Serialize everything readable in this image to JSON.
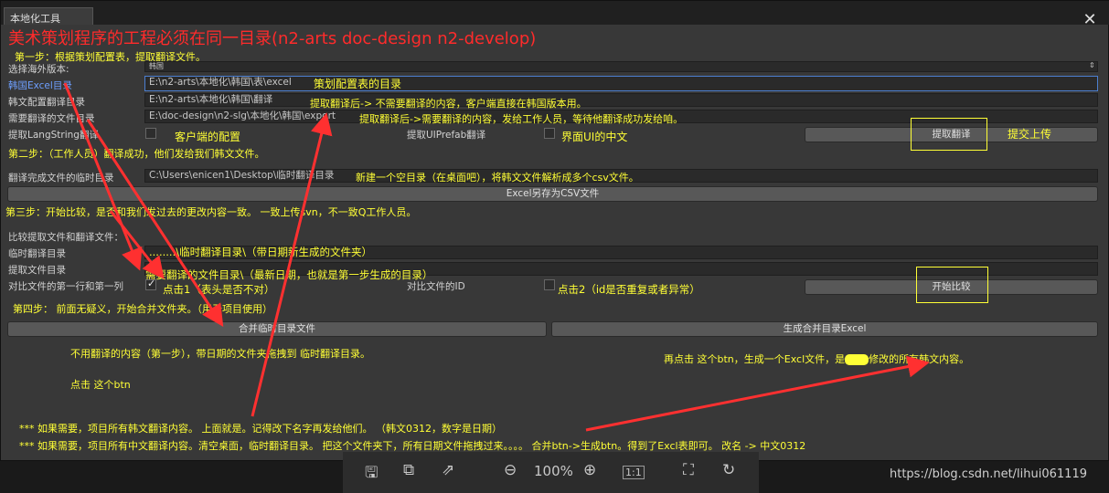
{
  "window": {
    "tab_title": "本地化工具",
    "close_glyph": "✕"
  },
  "notes": {
    "headline": "美术策划程序的工程必须在同一目录(n2-arts  doc-design  n2-develop)",
    "step1": "第一步：根据策划配置表，提取翻译文件。",
    "excel_hint": "策划配置表的目录",
    "korean_hint": "提取翻译后-> 不需要翻译的内容，客户端直接在韩国版本用。",
    "need_hint": "提取翻译后->需要翻译的内容，发给工作人员，等待他翻译成功发给咱。",
    "client_cfg": "客户端的配置",
    "ui_cn": "界面UI的中文",
    "submit_upload": "提交上传",
    "step2": "第二步：（工作人员）翻译成功，他们发给我们韩文文件。",
    "temp_hint": "新建一个空目录（在桌面吧），将韩文文件解析成多个csv文件。",
    "step3": "第三步：开始比较，是否和我们发过去的更改内容一致。  一致上传svn，不一致Q工作人员。",
    "temp_path_note": "........\\临时翻译目录\\（带日期新生成的文件夹）",
    "extract_path_note": "需要翻译的文件目录\\（最新日期，也就是第一步生成的目录）",
    "click1": "点击1（表头是否不对）",
    "click2": "点击2（id是否重复或者异常）",
    "step4": "第四步：  前面无疑义，开始合并文件夹。（用于项目使用）",
    "drag_note": "不用翻译的内容（第一步），带日期的文件夹拖拽到 临时翻译目录。",
    "click_btn": "点击   这个btn",
    "gen_note": "再点击 这个btn，生成一个Excl文件，是",
    "gen_note2": "修改的所有韩文内容。",
    "bottom1": "*** 如果需要，项目所有韩文翻译内容。    上面就是。记得改下名字再发给他们。  （韩文0312，数字是日期）",
    "bottom2": "*** 如果需要，项目所有中文翻译内容。清空桌面，临时翻译目录。  把这个文件夹下，所有日期文件拖拽过来。。。。 合并btn->生成btn。得到了Excl表即可。 改名 -> 中文0312"
  },
  "form": {
    "overseas_label": "选择海外版本:",
    "overseas_value": "韩国",
    "excel_dir_label": "韩国Excel目录",
    "excel_dir_value": "E:\\n2-arts\\本地化\\韩国\\表\\excel",
    "korean_dir_label": "韩文配置翻译目录",
    "korean_dir_value": "E:\\n2-arts\\本地化\\韩国\\翻译",
    "need_dir_label": "需要翻译的文件目录",
    "need_dir_value": "E:\\doc-design\\n2-slg\\本地化\\韩国\\export",
    "langstring_label": "提取LangString翻译",
    "uiprefab_label": "提取UIPrefab翻译",
    "extract_button": "提取翻译",
    "temp_dir_label": "翻译完成文件的临时目录",
    "temp_dir_value": "C:\\Users\\enicen1\\Desktop\\临时翻译目录",
    "excel_csv_button": "Excel另存为CSV文件",
    "compare_title": "比较提取文件和翻译文件：",
    "temp_label": "临时翻译目录",
    "extract_label": "提取文件目录",
    "compare_first_label": "对比文件的第一行和第一列",
    "compare_id_label": "对比文件的ID",
    "compare_button": "开始比较",
    "merge_button": "合并临时目录文件",
    "generate_button": "生成合并目录Excel"
  },
  "toolbar": {
    "zoom": "100%",
    "one_to_one": "1:1"
  },
  "watermark": "https://blog.csdn.net/lihui061119"
}
